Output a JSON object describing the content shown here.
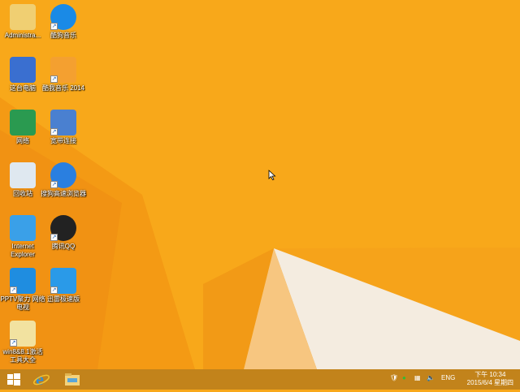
{
  "desktop": {
    "icons": [
      {
        "label": "Administra...",
        "icon": "user-folder-icon",
        "shortcut": false
      },
      {
        "label": "酷狗音乐",
        "icon": "kugou-icon",
        "shortcut": true
      },
      {
        "label": "这台电脑",
        "icon": "computer-icon",
        "shortcut": false
      },
      {
        "label": "酷我音乐 2014",
        "icon": "kuwo-icon",
        "shortcut": true
      },
      {
        "label": "网络",
        "icon": "network-icon",
        "shortcut": false
      },
      {
        "label": "宽带连接",
        "icon": "broadband-icon",
        "shortcut": true
      },
      {
        "label": "回收站",
        "icon": "recycle-bin-icon",
        "shortcut": false
      },
      {
        "label": "搜狗高速浏览器",
        "icon": "sogou-browser-icon",
        "shortcut": true
      },
      {
        "label": "Internet Explorer",
        "icon": "ie-icon",
        "shortcut": false
      },
      {
        "label": "腾讯QQ",
        "icon": "qq-icon",
        "shortcut": true
      },
      {
        "label": "PPTV聚力 网络电视",
        "icon": "pptv-icon",
        "shortcut": true
      },
      {
        "label": "迅雷极速版",
        "icon": "xunlei-icon",
        "shortcut": true
      },
      {
        "label": "win8&8.1激活工具大全",
        "icon": "folder-icon",
        "shortcut": true
      }
    ]
  },
  "taskbar": {
    "pinned": [
      "start-icon",
      "ie-icon",
      "file-explorer-icon"
    ],
    "tray": {
      "language": "ENG",
      "time": "下午 10:34",
      "date": "2015/6/4 星期四"
    }
  },
  "colors": {
    "background": "#f8a81a",
    "accent_dark": "#ee8a10",
    "wedge": "#f3e9d8"
  }
}
